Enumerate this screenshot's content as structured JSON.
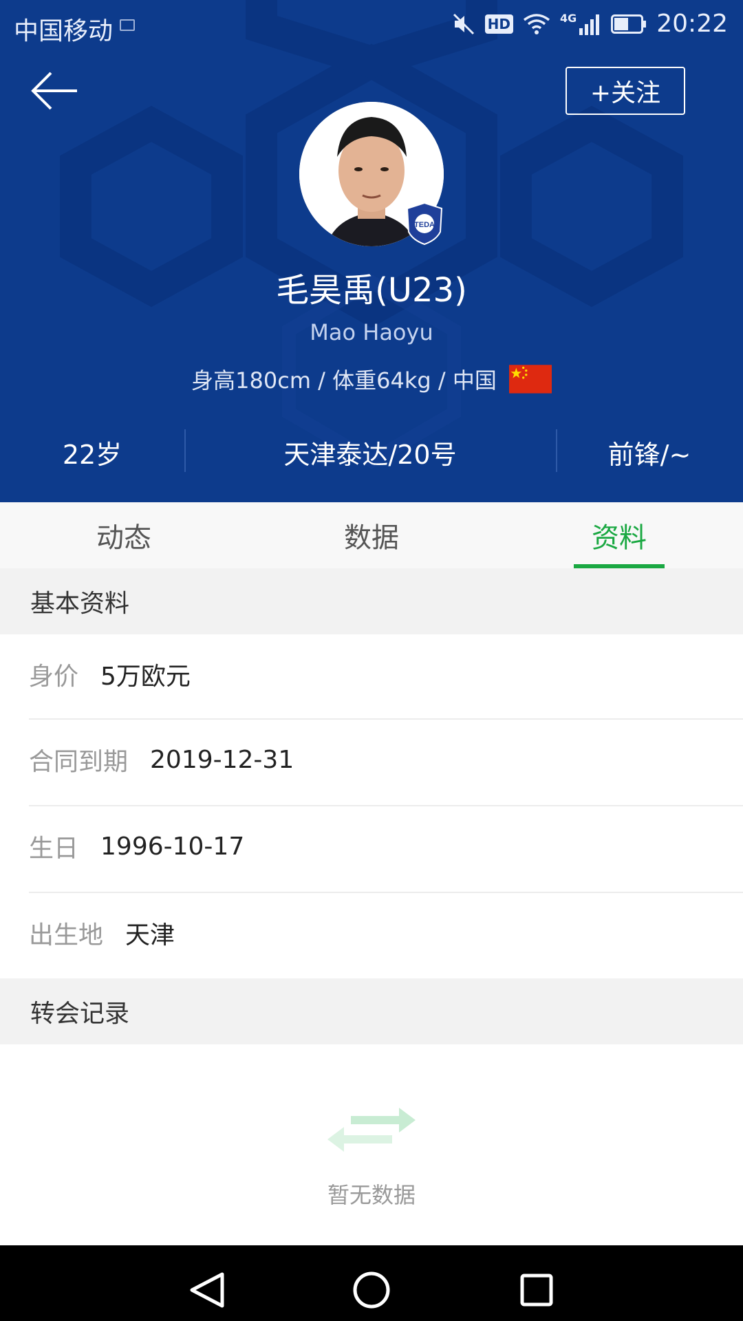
{
  "status_bar": {
    "carrier": "中国移动",
    "hd": "HD",
    "network": "4G",
    "time": "20:22"
  },
  "header": {
    "follow_label": "+关注",
    "player_name": "毛昊禹(U23)",
    "player_name_en": "Mao Haoyu",
    "meta": "身高180cm / 体重64kg / 中国",
    "club_badge_text": "TEDA",
    "stats": {
      "age": "22岁",
      "club": "天津泰达/20号",
      "position": "前锋/~"
    },
    "colors": {
      "background": "#0d3b8c",
      "accent": "#1aa842"
    }
  },
  "tabs": [
    {
      "label": "动态"
    },
    {
      "label": "数据"
    },
    {
      "label": "资料",
      "active": true
    }
  ],
  "basic_info": {
    "title": "基本资料",
    "rows": [
      {
        "key": "身价",
        "value": "5万欧元"
      },
      {
        "key": "合同到期",
        "value": "2019-12-31"
      },
      {
        "key": "生日",
        "value": "1996-10-17"
      },
      {
        "key": "出生地",
        "value": "天津"
      }
    ]
  },
  "transfer": {
    "title": "转会记录",
    "empty_text": "暂无数据"
  }
}
